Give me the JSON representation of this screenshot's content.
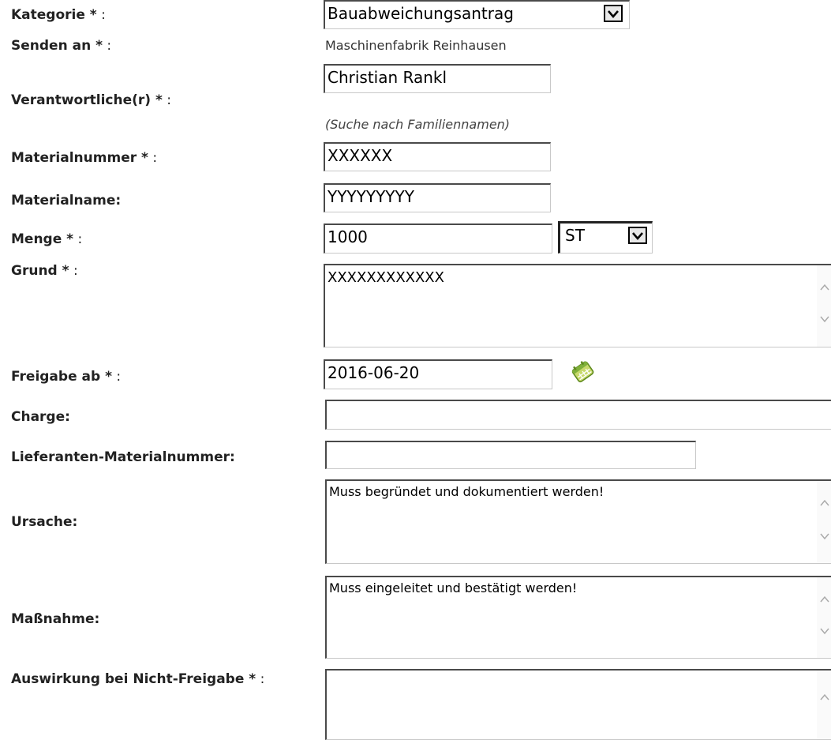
{
  "form": {
    "kategorie": {
      "label": "Kategorie *",
      "value": "Bauabweichungsantrag"
    },
    "senden_an": {
      "label": "Senden an *",
      "value": "Maschinenfabrik Reinhausen"
    },
    "verantwortliche": {
      "label": "Verantwortliche(r) *",
      "value": "Christian Rankl",
      "hint": "(Suche nach Familiennamen)"
    },
    "materialnummer": {
      "label": "Materialnummer *",
      "value": "XXXXXX"
    },
    "materialname": {
      "label": "Materialname:",
      "value": "YYYYYYYYY"
    },
    "menge": {
      "label": "Menge *",
      "value": "1000",
      "unit": "ST"
    },
    "grund": {
      "label": "Grund *",
      "value": "XXXXXXXXXXXX"
    },
    "freigabe_ab": {
      "label": "Freigabe ab *",
      "value": "2016-06-20",
      "icon": "calendar-icon"
    },
    "charge": {
      "label": "Charge:",
      "value": ""
    },
    "lieferanten_materialnummer": {
      "label": "Lieferanten-Materialnummer:",
      "value": ""
    },
    "ursache": {
      "label": "Ursache:",
      "value": "Muss begründet und dokumentiert werden!"
    },
    "massnahme": {
      "label": "Maßnahme:",
      "value": "Muss eingeleitet und bestätigt werden!"
    },
    "auswirkung": {
      "label": "Auswirkung bei Nicht-Freigabe *",
      "value": ""
    },
    "colon": ":"
  }
}
